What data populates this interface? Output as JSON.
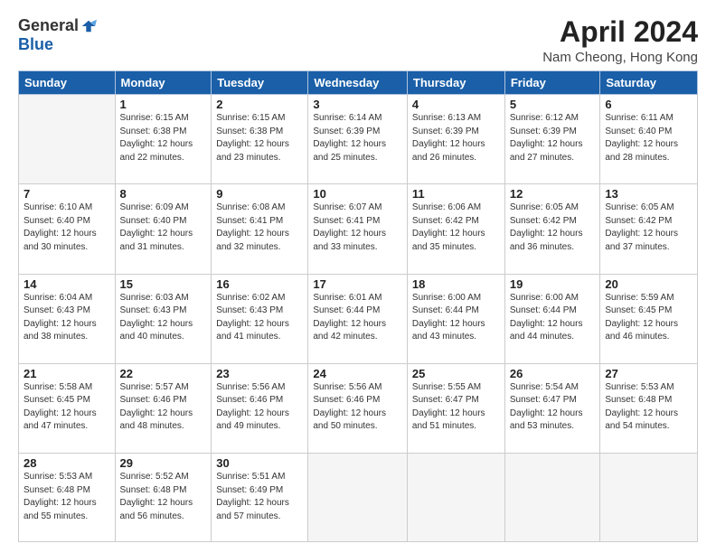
{
  "logo": {
    "general": "General",
    "blue": "Blue"
  },
  "title": "April 2024",
  "location": "Nam Cheong, Hong Kong",
  "days_header": [
    "Sunday",
    "Monday",
    "Tuesday",
    "Wednesday",
    "Thursday",
    "Friday",
    "Saturday"
  ],
  "weeks": [
    [
      {
        "day": "",
        "info": ""
      },
      {
        "day": "1",
        "info": "Sunrise: 6:15 AM\nSunset: 6:38 PM\nDaylight: 12 hours\nand 22 minutes."
      },
      {
        "day": "2",
        "info": "Sunrise: 6:15 AM\nSunset: 6:38 PM\nDaylight: 12 hours\nand 23 minutes."
      },
      {
        "day": "3",
        "info": "Sunrise: 6:14 AM\nSunset: 6:39 PM\nDaylight: 12 hours\nand 25 minutes."
      },
      {
        "day": "4",
        "info": "Sunrise: 6:13 AM\nSunset: 6:39 PM\nDaylight: 12 hours\nand 26 minutes."
      },
      {
        "day": "5",
        "info": "Sunrise: 6:12 AM\nSunset: 6:39 PM\nDaylight: 12 hours\nand 27 minutes."
      },
      {
        "day": "6",
        "info": "Sunrise: 6:11 AM\nSunset: 6:40 PM\nDaylight: 12 hours\nand 28 minutes."
      }
    ],
    [
      {
        "day": "7",
        "info": "Sunrise: 6:10 AM\nSunset: 6:40 PM\nDaylight: 12 hours\nand 30 minutes."
      },
      {
        "day": "8",
        "info": "Sunrise: 6:09 AM\nSunset: 6:40 PM\nDaylight: 12 hours\nand 31 minutes."
      },
      {
        "day": "9",
        "info": "Sunrise: 6:08 AM\nSunset: 6:41 PM\nDaylight: 12 hours\nand 32 minutes."
      },
      {
        "day": "10",
        "info": "Sunrise: 6:07 AM\nSunset: 6:41 PM\nDaylight: 12 hours\nand 33 minutes."
      },
      {
        "day": "11",
        "info": "Sunrise: 6:06 AM\nSunset: 6:42 PM\nDaylight: 12 hours\nand 35 minutes."
      },
      {
        "day": "12",
        "info": "Sunrise: 6:05 AM\nSunset: 6:42 PM\nDaylight: 12 hours\nand 36 minutes."
      },
      {
        "day": "13",
        "info": "Sunrise: 6:05 AM\nSunset: 6:42 PM\nDaylight: 12 hours\nand 37 minutes."
      }
    ],
    [
      {
        "day": "14",
        "info": "Sunrise: 6:04 AM\nSunset: 6:43 PM\nDaylight: 12 hours\nand 38 minutes."
      },
      {
        "day": "15",
        "info": "Sunrise: 6:03 AM\nSunset: 6:43 PM\nDaylight: 12 hours\nand 40 minutes."
      },
      {
        "day": "16",
        "info": "Sunrise: 6:02 AM\nSunset: 6:43 PM\nDaylight: 12 hours\nand 41 minutes."
      },
      {
        "day": "17",
        "info": "Sunrise: 6:01 AM\nSunset: 6:44 PM\nDaylight: 12 hours\nand 42 minutes."
      },
      {
        "day": "18",
        "info": "Sunrise: 6:00 AM\nSunset: 6:44 PM\nDaylight: 12 hours\nand 43 minutes."
      },
      {
        "day": "19",
        "info": "Sunrise: 6:00 AM\nSunset: 6:44 PM\nDaylight: 12 hours\nand 44 minutes."
      },
      {
        "day": "20",
        "info": "Sunrise: 5:59 AM\nSunset: 6:45 PM\nDaylight: 12 hours\nand 46 minutes."
      }
    ],
    [
      {
        "day": "21",
        "info": "Sunrise: 5:58 AM\nSunset: 6:45 PM\nDaylight: 12 hours\nand 47 minutes."
      },
      {
        "day": "22",
        "info": "Sunrise: 5:57 AM\nSunset: 6:46 PM\nDaylight: 12 hours\nand 48 minutes."
      },
      {
        "day": "23",
        "info": "Sunrise: 5:56 AM\nSunset: 6:46 PM\nDaylight: 12 hours\nand 49 minutes."
      },
      {
        "day": "24",
        "info": "Sunrise: 5:56 AM\nSunset: 6:46 PM\nDaylight: 12 hours\nand 50 minutes."
      },
      {
        "day": "25",
        "info": "Sunrise: 5:55 AM\nSunset: 6:47 PM\nDaylight: 12 hours\nand 51 minutes."
      },
      {
        "day": "26",
        "info": "Sunrise: 5:54 AM\nSunset: 6:47 PM\nDaylight: 12 hours\nand 53 minutes."
      },
      {
        "day": "27",
        "info": "Sunrise: 5:53 AM\nSunset: 6:48 PM\nDaylight: 12 hours\nand 54 minutes."
      }
    ],
    [
      {
        "day": "28",
        "info": "Sunrise: 5:53 AM\nSunset: 6:48 PM\nDaylight: 12 hours\nand 55 minutes."
      },
      {
        "day": "29",
        "info": "Sunrise: 5:52 AM\nSunset: 6:48 PM\nDaylight: 12 hours\nand 56 minutes."
      },
      {
        "day": "30",
        "info": "Sunrise: 5:51 AM\nSunset: 6:49 PM\nDaylight: 12 hours\nand 57 minutes."
      },
      {
        "day": "",
        "info": ""
      },
      {
        "day": "",
        "info": ""
      },
      {
        "day": "",
        "info": ""
      },
      {
        "day": "",
        "info": ""
      }
    ]
  ]
}
